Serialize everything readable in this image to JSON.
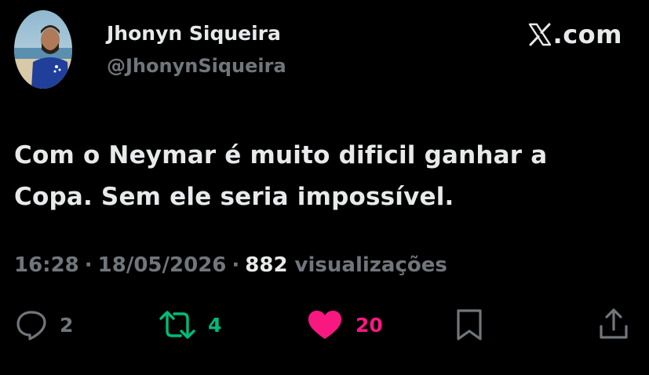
{
  "user": {
    "name": "Jhonyn Siqueira",
    "handle": "@JhonynSiqueira",
    "avatar_icon": "profile-photo"
  },
  "brand": {
    "logo_icon": "x-logo-icon",
    "suffix": ".com"
  },
  "tweet": {
    "line1": "Com o Neymar é muito dificil ganhar a",
    "line2": "Copa. Sem ele seria impossível."
  },
  "meta": {
    "time": "16:28",
    "separator1": "·",
    "date": "18/05/2026",
    "separator2": "·",
    "views_count": "882",
    "views_label": "visualizações"
  },
  "actions": {
    "reply": {
      "icon": "reply-icon",
      "count": "2"
    },
    "retweet": {
      "icon": "retweet-icon",
      "count": "4"
    },
    "like": {
      "icon": "heart-icon",
      "count": "20"
    },
    "bookmark": {
      "icon": "bookmark-icon"
    },
    "share": {
      "icon": "share-icon"
    }
  },
  "colors": {
    "background": "#000000",
    "text_primary": "#e7e9ea",
    "text_secondary": "#71767b",
    "retweet_green": "#00ba7c",
    "like_pink": "#f91880"
  }
}
